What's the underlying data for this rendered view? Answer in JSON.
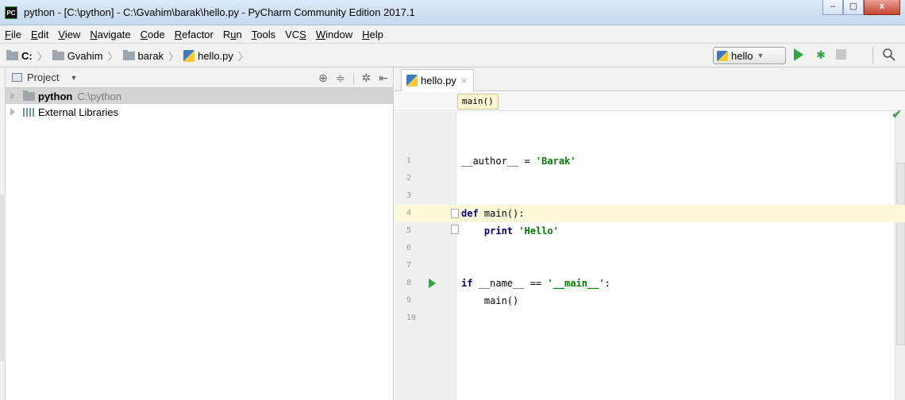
{
  "window": {
    "app_icon_text": "PC",
    "title": "python - [C:\\python] - C:\\Gvahim\\barak\\hello.py - PyCharm Community Edition 2017.1",
    "minimize": "‒",
    "maximize": "▢",
    "close": "x"
  },
  "menu": [
    {
      "mn": "F",
      "rest": "ile"
    },
    {
      "mn": "E",
      "rest": "dit"
    },
    {
      "mn": "V",
      "rest": "iew"
    },
    {
      "mn": "N",
      "rest": "avigate"
    },
    {
      "mn": "C",
      "rest": "ode"
    },
    {
      "mn": "R",
      "rest": "efactor"
    },
    {
      "pre": "R",
      "mn": "u",
      "rest": "n"
    },
    {
      "mn": "T",
      "rest": "ools"
    },
    {
      "pre": "VC",
      "mn": "S",
      "rest": ""
    },
    {
      "mn": "W",
      "rest": "indow"
    },
    {
      "mn": "H",
      "rest": "elp"
    }
  ],
  "nav": {
    "crumbs": [
      "C:",
      "Gvahim",
      "barak",
      "hello.py"
    ],
    "run_config": "hello",
    "search_icon": "magnifier"
  },
  "project": {
    "title": "Project",
    "tree": [
      {
        "name": "python",
        "path": "C:\\python"
      },
      {
        "name": "External Libraries"
      }
    ]
  },
  "editor": {
    "tab_label": "hello.py",
    "tab_close": "×",
    "breadcrumb_func": "main()",
    "current_line": 4,
    "lines": [
      {
        "n": "1",
        "text": "__author__ = 'Barak'"
      },
      {
        "n": "2",
        "text": ""
      },
      {
        "n": "3",
        "text": ""
      },
      {
        "n": "4",
        "text": "def main():"
      },
      {
        "n": "5",
        "text": "    print 'Hello'"
      },
      {
        "n": "6",
        "text": ""
      },
      {
        "n": "7",
        "text": ""
      },
      {
        "n": "8",
        "text": "if __name__ == '__main__':"
      },
      {
        "n": "9",
        "text": "    main()"
      },
      {
        "n": "10",
        "text": ""
      }
    ]
  },
  "colors": {
    "keyword": "#000080",
    "string": "#008000",
    "run_green": "#31a349",
    "current_line": "#fdf9d8"
  }
}
